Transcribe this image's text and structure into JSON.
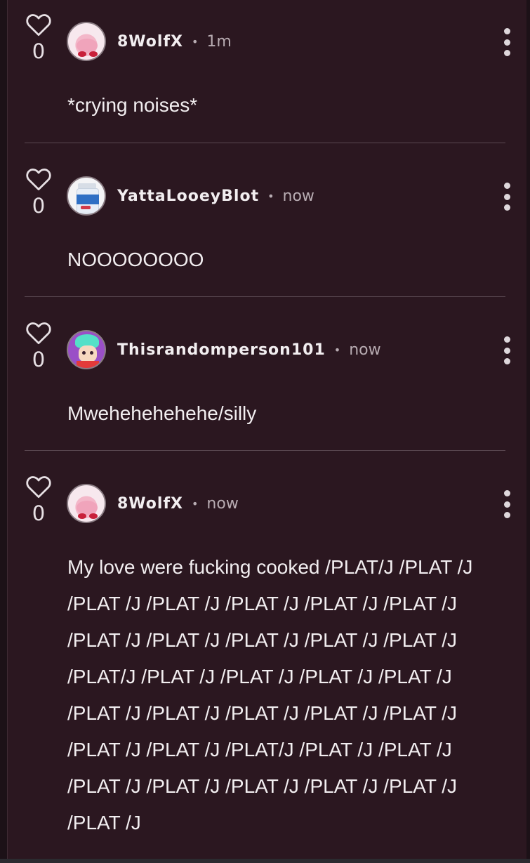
{
  "comments": [
    {
      "likes": "0",
      "username": "8WolfX",
      "time": "1m",
      "avatar": "kirby-avatar",
      "text": "*crying noises*"
    },
    {
      "likes": "0",
      "username": "YattaLooeyBlot",
      "time": "now",
      "avatar": "bottle-avatar",
      "text": "NOOOOOOOO"
    },
    {
      "likes": "0",
      "username": "Thisrandomperson101",
      "time": "now",
      "avatar": "character-avatar",
      "text": "Mwehehehehehe/silly"
    },
    {
      "likes": "0",
      "username": "8WolfX",
      "time": "now",
      "avatar": "kirby-avatar",
      "text": "My love were fucking cooked /PLAT/J /PLAT /J /PLAT /J /PLAT /J /PLAT /J /PLAT /J /PLAT /J /PLAT /J /PLAT /J /PLAT /J /PLAT /J /PLAT /J /PLAT/J /PLAT /J /PLAT /J /PLAT /J /PLAT /J /PLAT /J /PLAT /J /PLAT /J /PLAT /J /PLAT /J /PLAT /J /PLAT /J /PLAT/J /PLAT /J /PLAT /J /PLAT /J /PLAT /J /PLAT /J /PLAT /J /PLAT /J /PLAT /J"
    }
  ],
  "separator": "•"
}
